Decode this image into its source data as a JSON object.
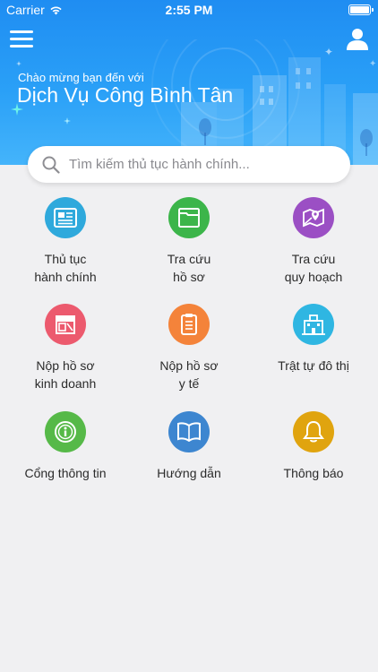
{
  "status_bar": {
    "carrier": "Carrier",
    "time": "2:55 PM"
  },
  "header": {
    "welcome": "Chào mừng bạn đến với",
    "app_name": "Dịch Vụ Công Bình Tân",
    "menu_icon": "hamburger-icon",
    "user_icon": "user-icon"
  },
  "search": {
    "placeholder": "Tìm kiếm thủ tục hành chính...",
    "icon": "search-icon"
  },
  "colors": {
    "header_top": "#1f8df2",
    "header_bottom": "#44b4fb",
    "background": "#f0f0f2"
  },
  "menu": [
    {
      "line1": "Thủ tục",
      "line2": "hành chính",
      "icon": "document-icon",
      "color": "#2fa9dc"
    },
    {
      "line1": "Tra cứu",
      "line2": "hồ sơ",
      "icon": "folder-icon",
      "color": "#3cb54a"
    },
    {
      "line1": "Tra cứu",
      "line2": "quy hoạch",
      "icon": "map-pin-icon",
      "color": "#9b4fc4"
    },
    {
      "line1": "Nộp hồ sơ",
      "line2": "kinh doanh",
      "icon": "store-icon",
      "color": "#ec5a6e"
    },
    {
      "line1": "Nộp hồ sơ",
      "line2": "y tế",
      "icon": "clipboard-icon",
      "color": "#f4833a"
    },
    {
      "line1": "Trật tự đô thị",
      "line2": "",
      "icon": "city-building-icon",
      "color": "#2fb6e2"
    },
    {
      "line1": "Cổng thông tin",
      "line2": "",
      "icon": "info-icon",
      "color": "#56b948"
    },
    {
      "line1": "Hướng dẫn",
      "line2": "",
      "icon": "book-icon",
      "color": "#3d86d0"
    },
    {
      "line1": "Thông báo",
      "line2": "",
      "icon": "bell-icon",
      "color": "#e0a40f"
    }
  ]
}
